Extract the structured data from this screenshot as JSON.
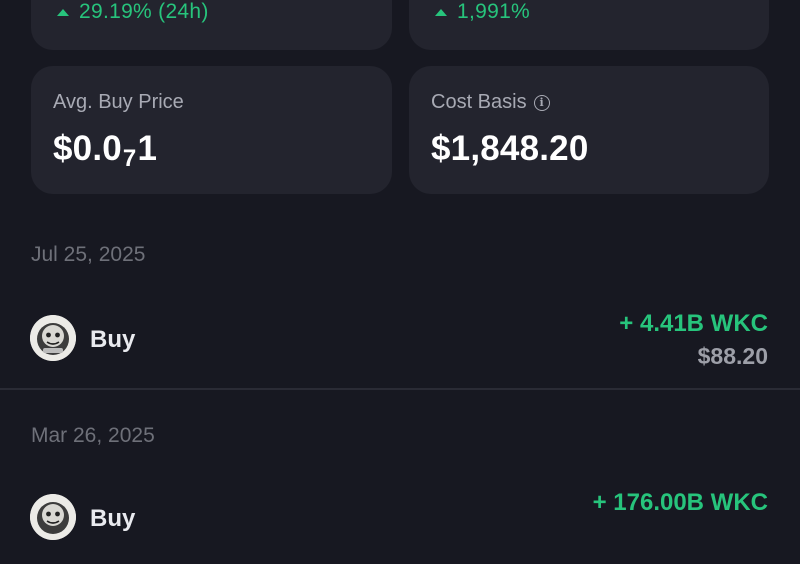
{
  "stats": {
    "change_24h": "29.19% (24h)",
    "change_total": "1,991%",
    "avg_buy_price": {
      "label": "Avg. Buy Price",
      "value_prefix": "$0.0",
      "value_sub": "7",
      "value_suffix": "1"
    },
    "cost_basis": {
      "label": "Cost Basis",
      "info_icon": "info-icon",
      "value": "$1,848.20"
    }
  },
  "transactions": [
    {
      "date": "Jul 25, 2025",
      "type": "Buy",
      "amount": "+ 4.41B WKC",
      "usd": "$88.20",
      "icon": "wkc-token-avatar"
    },
    {
      "date": "Mar 26, 2025",
      "type": "Buy",
      "amount": "+ 176.00B WKC",
      "icon": "wkc-token-avatar"
    }
  ],
  "colors": {
    "background": "#171821",
    "card": "#23242e",
    "positive": "#27c47c",
    "muted": "#a8aab4",
    "date": "#6e7079"
  }
}
